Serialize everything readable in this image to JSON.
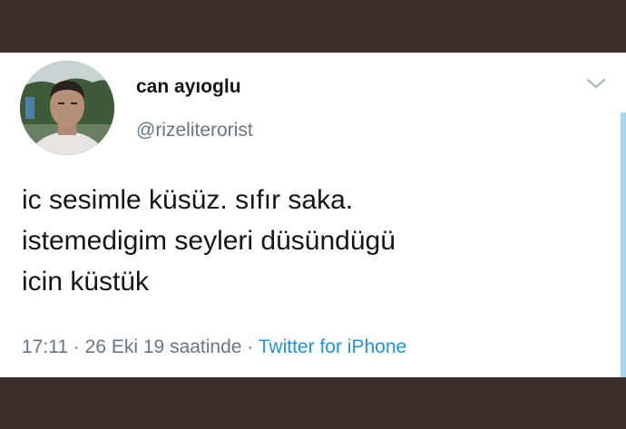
{
  "tweet": {
    "author": {
      "display_name": "can ayıoglu",
      "handle": "@rizeliterorist",
      "avatar_icon": "profile-photo"
    },
    "text_lines": [
      "ic sesimle küsüz. sıfır saka.",
      "istemedigim seyleri düsündügü",
      "icin küstük"
    ],
    "meta": {
      "time": "17:11",
      "separator_1": " · ",
      "date": "26 Eki 19 saatinde",
      "separator_2": " · ",
      "source": "Twitter for iPhone"
    },
    "menu_icon": "chevron-down-icon"
  },
  "colors": {
    "background": "#3a2f2b",
    "card": "#ffffff",
    "text_primary": "#14171a",
    "text_secondary": "#657786",
    "link": "#1b95e0"
  }
}
